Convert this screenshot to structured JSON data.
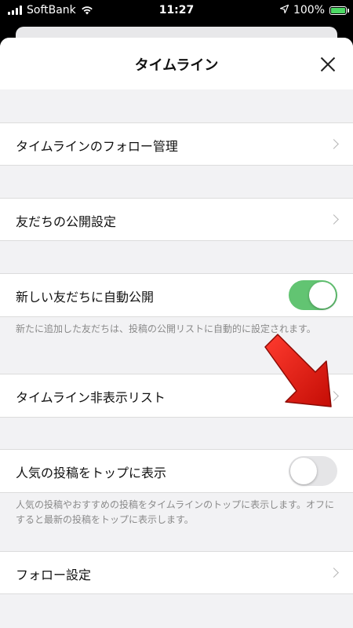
{
  "status_bar": {
    "carrier": "SoftBank",
    "time": "11:27",
    "battery": "100%",
    "icons": [
      "signal-bars-icon",
      "wifi-icon",
      "location-arrow-icon",
      "battery-charging-icon"
    ]
  },
  "header": {
    "title": "タイムライン",
    "close_icon": "close-icon"
  },
  "rows": [
    {
      "label": "タイムラインのフォロー管理",
      "type": "link"
    },
    {
      "label": "友だちの公開設定",
      "type": "link"
    },
    {
      "label": "新しい友だちに自動公開",
      "type": "toggle",
      "on": true,
      "description": "新たに追加した友だちは、投稿の公開リストに自動的に設定されます。"
    },
    {
      "label": "タイムライン非表示リスト",
      "type": "link"
    },
    {
      "label": "人気の投稿をトップに表示",
      "type": "toggle",
      "on": false,
      "description": "人気の投稿やおすすめの投稿をタイムラインのトップに表示します。オフにすると最新の投稿をトップに表示します。"
    },
    {
      "label": "フォロー設定",
      "type": "link"
    }
  ],
  "colors": {
    "toggle_on": "#62c472",
    "toggle_off": "#e5e5e7",
    "background": "#f2f2f4",
    "annotation_arrow": "#e8160c"
  },
  "annotation": "red-arrow-pointing-to-row"
}
